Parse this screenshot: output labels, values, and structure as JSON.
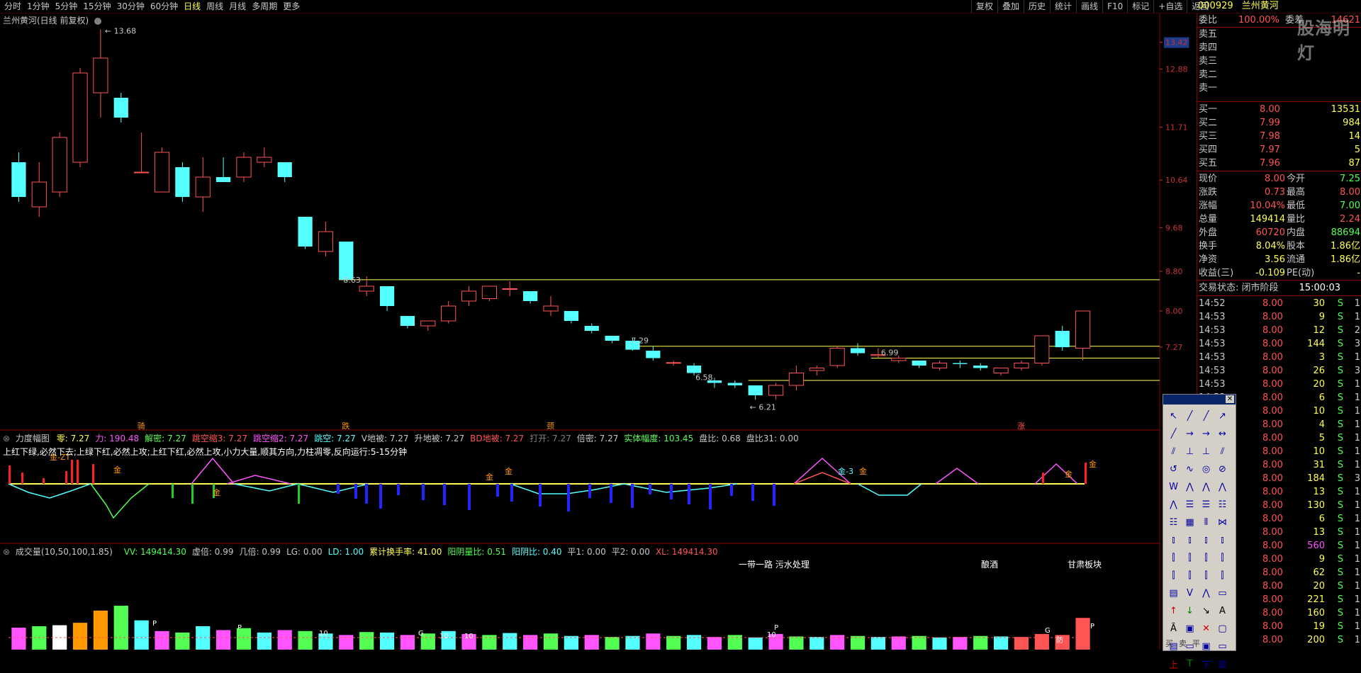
{
  "toolbar": {
    "periods": [
      "分时",
      "1分钟",
      "5分钟",
      "15分钟",
      "30分钟",
      "60分钟",
      "日线",
      "周线",
      "月线",
      "多周期",
      "更多"
    ],
    "active_period": "日线",
    "tools": [
      "复权",
      "叠加",
      "历史",
      "统计",
      "画线",
      "F10",
      "标记",
      "+自选",
      "返回"
    ]
  },
  "stock": {
    "code": "000929",
    "name": "兰州黄河",
    "chart_label": "兰州黄河(日线 前复权)"
  },
  "watermark": "股海明灯",
  "price_axis": {
    "labels": [
      "13.42",
      "12.88",
      "11.71",
      "10.64",
      "9.68",
      "8.80",
      "8.00",
      "7.27"
    ],
    "current_price_label": "13.42"
  },
  "annotations": {
    "high": "13.68",
    "low": "6.21",
    "level_863": "8.63",
    "level_729": "7.29",
    "level_699": "6.99",
    "level_658": "6.58",
    "markers": [
      "骑",
      "跌",
      "颈",
      "涨"
    ]
  },
  "indicator": {
    "name": "力度幅图",
    "items": [
      {
        "label": "零: 7.27",
        "color": "#ffff54"
      },
      {
        "label": "力: 190.48",
        "color": "#ff54ff"
      },
      {
        "label": "解密: 7.27",
        "color": "#54ff54"
      },
      {
        "label": "跳空缩3: 7.27",
        "color": "#ff5454"
      },
      {
        "label": "跳空缩2: 7.27",
        "color": "#ff54ff"
      },
      {
        "label": "跳空: 7.27",
        "color": "#54ffff"
      },
      {
        "label": "V地被: 7.27",
        "color": "#c8c8c8"
      },
      {
        "label": "升地被: 7.27",
        "color": "#c8c8c8"
      },
      {
        "label": "BD地被: 7.27",
        "color": "#ff5454"
      },
      {
        "label": "打开: 7.27",
        "color": "#808080"
      },
      {
        "label": "倍密: 7.27",
        "color": "#c8c8c8"
      },
      {
        "label": "实体幅度: 103.45",
        "color": "#54ff54"
      },
      {
        "label": "盘比: 0.68",
        "color": "#c8c8c8"
      },
      {
        "label": "盘比31: 0.00",
        "color": "#c8c8c8"
      }
    ],
    "description": "上红下绿,必然下去;上绿下红,必然上攻;上红下红,必然上攻,小力大量,顺其方向,力柱凋零,反向运行:5-15分钟",
    "marks": [
      "金-ZT",
      "金",
      "金",
      "金",
      "金",
      "金-3",
      "金",
      "金",
      "金"
    ]
  },
  "volume": {
    "name": "成交量(10,50,100,1.85)",
    "items": [
      {
        "label": "VV: 149414.30",
        "color": "#54ff54"
      },
      {
        "label": "虚倍: 0.99",
        "color": "#c8c8c8"
      },
      {
        "label": "几倍: 0.99",
        "color": "#c8c8c8"
      },
      {
        "label": "LG: 0.00",
        "color": "#c8c8c8"
      },
      {
        "label": "LD: 1.00",
        "color": "#54ffff"
      },
      {
        "label": "累计换手率: 41.00",
        "color": "#ffff54"
      },
      {
        "label": "阳阴量比: 0.51",
        "color": "#54ff54"
      },
      {
        "label": "阳阴比: 0.40",
        "color": "#54ffff"
      },
      {
        "label": "平1: 0.00",
        "color": "#c8c8c8"
      },
      {
        "label": "平2: 0.00",
        "color": "#c8c8c8"
      },
      {
        "label": "XL: 149414.30",
        "color": "#ff5454"
      }
    ],
    "tags": [
      "一带一路 污水处理",
      "酿酒",
      "甘肃板块"
    ],
    "bar_marks": [
      "P",
      "P",
      "10",
      "G",
      "10",
      "10",
      "10",
      "P",
      "G",
      "P",
      "防"
    ]
  },
  "order_book": {
    "weibi_label": "委比",
    "weibi_value": "100.00%",
    "weicha_label": "委差",
    "weicha_value": "14621",
    "asks": [
      {
        "label": "卖五",
        "price": "",
        "vol": ""
      },
      {
        "label": "卖四",
        "price": "",
        "vol": ""
      },
      {
        "label": "卖三",
        "price": "",
        "vol": ""
      },
      {
        "label": "卖二",
        "price": "",
        "vol": ""
      },
      {
        "label": "卖一",
        "price": "",
        "vol": ""
      }
    ],
    "bids": [
      {
        "label": "买一",
        "price": "8.00",
        "vol": "13531"
      },
      {
        "label": "买二",
        "price": "7.99",
        "vol": "984"
      },
      {
        "label": "买三",
        "price": "7.98",
        "vol": "14"
      },
      {
        "label": "买四",
        "price": "7.97",
        "vol": "5"
      },
      {
        "label": "买五",
        "price": "7.96",
        "vol": "87"
      }
    ]
  },
  "stats": [
    {
      "l1": "现价",
      "v1": "8.00",
      "c1": "#ff5454",
      "l2": "今开",
      "v2": "7.25",
      "c2": "#54ff54"
    },
    {
      "l1": "涨跌",
      "v1": "0.73",
      "c1": "#ff5454",
      "l2": "最高",
      "v2": "8.00",
      "c2": "#ff5454"
    },
    {
      "l1": "涨幅",
      "v1": "10.04%",
      "c1": "#ff5454",
      "l2": "最低",
      "v2": "7.00",
      "c2": "#54ff54"
    },
    {
      "l1": "总量",
      "v1": "149414",
      "c1": "#ffff54",
      "l2": "量比",
      "v2": "2.24",
      "c2": "#ff5454"
    },
    {
      "l1": "外盘",
      "v1": "60720",
      "c1": "#ff5454",
      "l2": "内盘",
      "v2": "88694",
      "c2": "#54ff54"
    },
    {
      "l1": "换手",
      "v1": "8.04%",
      "c1": "#ffff54",
      "l2": "股本",
      "v2": "1.86亿",
      "c2": "#ffff54"
    },
    {
      "l1": "净资",
      "v1": "3.56",
      "c1": "#ffff54",
      "l2": "流通",
      "v2": "1.86亿",
      "c2": "#ffff54"
    },
    {
      "l1": "收益(三)",
      "v1": "-0.109",
      "c1": "#ffff54",
      "l2": "PE(动)",
      "v2": "-",
      "c2": "#ffff54"
    }
  ],
  "trade_status": {
    "label": "交易状态: 闭市阶段",
    "time": "15:00:03"
  },
  "ticks": [
    {
      "t": "14:52",
      "p": "8.00",
      "v": "30",
      "s": "S",
      "n": "1"
    },
    {
      "t": "14:53",
      "p": "8.00",
      "v": "9",
      "s": "S",
      "n": "1"
    },
    {
      "t": "14:53",
      "p": "8.00",
      "v": "12",
      "s": "S",
      "n": "2"
    },
    {
      "t": "14:53",
      "p": "8.00",
      "v": "144",
      "s": "S",
      "n": "3"
    },
    {
      "t": "14:53",
      "p": "8.00",
      "v": "3",
      "s": "S",
      "n": "1"
    },
    {
      "t": "14:53",
      "p": "8.00",
      "v": "26",
      "s": "S",
      "n": "3"
    },
    {
      "t": "14:53",
      "p": "8.00",
      "v": "20",
      "s": "S",
      "n": "1"
    },
    {
      "t": "14:53",
      "p": "8.00",
      "v": "6",
      "s": "S",
      "n": "1"
    },
    {
      "t": "14:53",
      "p": "8.00",
      "v": "10",
      "s": "S",
      "n": "1"
    },
    {
      "t": "14:53",
      "p": "8.00",
      "v": "4",
      "s": "S",
      "n": "1"
    },
    {
      "t": "14:53",
      "p": "8.00",
      "v": "5",
      "s": "S",
      "n": "1"
    },
    {
      "t": "14:53",
      "p": "8.00",
      "v": "10",
      "s": "S",
      "n": "1"
    },
    {
      "t": "14:53",
      "p": "8.00",
      "v": "31",
      "s": "S",
      "n": "1"
    },
    {
      "t": "14:53",
      "p": "8.00",
      "v": "184",
      "s": "S",
      "n": "3"
    },
    {
      "t": "14:53",
      "p": "8.00",
      "v": "13",
      "s": "S",
      "n": "1"
    },
    {
      "t": "14:53",
      "p": "8.00",
      "v": "130",
      "s": "S",
      "n": "1"
    },
    {
      "t": "14:53",
      "p": "8.00",
      "v": "6",
      "s": "S",
      "n": "1"
    },
    {
      "t": "14:53",
      "p": "8.00",
      "v": "13",
      "s": "S",
      "n": "1"
    },
    {
      "t": "14:53",
      "p": "8.00",
      "v": "560",
      "s": "S",
      "n": "1"
    },
    {
      "t": "14:53",
      "p": "8.00",
      "v": "9",
      "s": "S",
      "n": "1"
    },
    {
      "t": "14:53",
      "p": "8.00",
      "v": "62",
      "s": "S",
      "n": "1"
    },
    {
      "t": "14:53",
      "p": "8.00",
      "v": "20",
      "s": "S",
      "n": "1"
    },
    {
      "t": "14:53",
      "p": "8.00",
      "v": "221",
      "s": "S",
      "n": "1"
    },
    {
      "t": "14:53",
      "p": "8.00",
      "v": "160",
      "s": "S",
      "n": "1"
    },
    {
      "t": "14:53",
      "p": "8.00",
      "v": "19",
      "s": "S",
      "n": "1"
    },
    {
      "t": "14:53",
      "p": "8.00",
      "v": "200",
      "s": "S",
      "n": "1"
    }
  ],
  "palette": {
    "footer": [
      "买",
      "卖",
      "平"
    ]
  },
  "chart_data": {
    "type": "candlestick",
    "title": "兰州黄河(日线 前复权)",
    "y_labels": [
      "13.42",
      "12.88",
      "11.71",
      "10.64",
      "9.68",
      "8.80",
      "8.00",
      "7.27"
    ],
    "candles": [
      {
        "o": 11.0,
        "c": 10.3,
        "h": 11.2,
        "l": 10.2
      },
      {
        "o": 10.1,
        "c": 10.6,
        "h": 11.0,
        "l": 9.9
      },
      {
        "o": 10.4,
        "c": 11.5,
        "h": 11.6,
        "l": 10.3
      },
      {
        "o": 11.0,
        "c": 12.8,
        "h": 12.9,
        "l": 10.9
      },
      {
        "o": 12.4,
        "c": 13.1,
        "h": 13.68,
        "l": 11.9
      },
      {
        "o": 12.3,
        "c": 11.9,
        "h": 12.4,
        "l": 11.8
      },
      {
        "o": 10.8,
        "c": 10.8,
        "h": 11.6,
        "l": 10.8
      },
      {
        "o": 10.4,
        "c": 11.2,
        "h": 11.3,
        "l": 10.4
      },
      {
        "o": 10.9,
        "c": 10.3,
        "h": 11.0,
        "l": 10.2
      },
      {
        "o": 10.3,
        "c": 10.7,
        "h": 11.1,
        "l": 10.0
      },
      {
        "o": 10.7,
        "c": 10.6,
        "h": 11.1,
        "l": 10.6
      },
      {
        "o": 10.7,
        "c": 11.1,
        "h": 11.2,
        "l": 10.6
      },
      {
        "o": 11.0,
        "c": 11.1,
        "h": 11.3,
        "l": 10.9
      },
      {
        "o": 11.0,
        "c": 10.7,
        "h": 11.0,
        "l": 10.6
      },
      {
        "o": 9.9,
        "c": 9.3,
        "h": 9.9,
        "l": 9.25
      },
      {
        "o": 9.2,
        "c": 9.6,
        "h": 9.8,
        "l": 9.1
      },
      {
        "o": 9.4,
        "c": 8.63,
        "h": 9.4,
        "l": 8.6
      },
      {
        "o": 8.4,
        "c": 8.5,
        "h": 8.7,
        "l": 8.3
      },
      {
        "o": 8.5,
        "c": 8.1,
        "h": 8.5,
        "l": 8.0
      },
      {
        "o": 7.9,
        "c": 7.7,
        "h": 7.9,
        "l": 7.65
      },
      {
        "o": 7.7,
        "c": 7.8,
        "h": 7.8,
        "l": 7.6
      },
      {
        "o": 7.8,
        "c": 8.1,
        "h": 8.2,
        "l": 7.75
      },
      {
        "o": 8.2,
        "c": 8.4,
        "h": 8.5,
        "l": 8.1
      },
      {
        "o": 8.25,
        "c": 8.5,
        "h": 8.5,
        "l": 8.2
      },
      {
        "o": 8.45,
        "c": 8.45,
        "h": 8.6,
        "l": 8.3
      },
      {
        "o": 8.4,
        "c": 8.2,
        "h": 8.4,
        "l": 8.15
      },
      {
        "o": 8.0,
        "c": 8.1,
        "h": 8.3,
        "l": 7.9
      },
      {
        "o": 8.0,
        "c": 7.8,
        "h": 8.0,
        "l": 7.75
      },
      {
        "o": 7.7,
        "c": 7.6,
        "h": 7.75,
        "l": 7.55
      },
      {
        "o": 7.5,
        "c": 7.4,
        "h": 7.5,
        "l": 7.35
      },
      {
        "o": 7.4,
        "c": 7.22,
        "h": 7.45,
        "l": 7.2
      },
      {
        "o": 7.2,
        "c": 7.05,
        "h": 7.29,
        "l": 7.0
      },
      {
        "o": 6.95,
        "c": 6.96,
        "h": 7.0,
        "l": 6.9
      },
      {
        "o": 6.9,
        "c": 6.75,
        "h": 6.95,
        "l": 6.7
      },
      {
        "o": 6.6,
        "c": 6.55,
        "h": 6.65,
        "l": 6.45
      },
      {
        "o": 6.55,
        "c": 6.5,
        "h": 6.6,
        "l": 6.45
      },
      {
        "o": 6.5,
        "c": 6.3,
        "h": 6.5,
        "l": 6.21
      },
      {
        "o": 6.3,
        "c": 6.5,
        "h": 6.55,
        "l": 6.21
      },
      {
        "o": 6.5,
        "c": 6.75,
        "h": 6.9,
        "l": 6.4
      },
      {
        "o": 6.8,
        "c": 6.85,
        "h": 6.9,
        "l": 6.7
      },
      {
        "o": 6.9,
        "c": 7.25,
        "h": 7.3,
        "l": 6.85
      },
      {
        "o": 7.25,
        "c": 7.15,
        "h": 7.35,
        "l": 7.1
      },
      {
        "o": 7.1,
        "c": 7.12,
        "h": 7.25,
        "l": 7.05
      },
      {
        "o": 7.0,
        "c": 7.05,
        "h": 7.1,
        "l": 6.95
      },
      {
        "o": 7.0,
        "c": 6.9,
        "h": 7.0,
        "l": 6.85
      },
      {
        "o": 6.85,
        "c": 6.95,
        "h": 7.0,
        "l": 6.8
      },
      {
        "o": 6.95,
        "c": 6.93,
        "h": 7.0,
        "l": 6.85
      },
      {
        "o": 6.9,
        "c": 6.85,
        "h": 6.95,
        "l": 6.8
      },
      {
        "o": 6.75,
        "c": 6.85,
        "h": 6.85,
        "l": 6.7
      },
      {
        "o": 6.85,
        "c": 6.95,
        "h": 7.0,
        "l": 6.8
      },
      {
        "o": 6.95,
        "c": 7.5,
        "h": 7.5,
        "l": 6.9
      },
      {
        "o": 7.6,
        "c": 7.27,
        "h": 7.7,
        "l": 7.2
      },
      {
        "o": 7.25,
        "c": 8.0,
        "h": 8.0,
        "l": 7.0
      }
    ],
    "h_lines": [
      8.63,
      7.29,
      7.05,
      6.6
    ],
    "volume": [
      45,
      48,
      50,
      55,
      80,
      90,
      60,
      38,
      35,
      48,
      40,
      44,
      35,
      40,
      38,
      33,
      30,
      36,
      35,
      30,
      33,
      38,
      32,
      30,
      34,
      30,
      33,
      28,
      30,
      26,
      28,
      33,
      28,
      30,
      26,
      30,
      25,
      32,
      27,
      26,
      30,
      28,
      26,
      27,
      28,
      25,
      26,
      28,
      27,
      26,
      32,
      30,
      65
    ],
    "ylim": [
      6.0,
      13.8
    ]
  }
}
